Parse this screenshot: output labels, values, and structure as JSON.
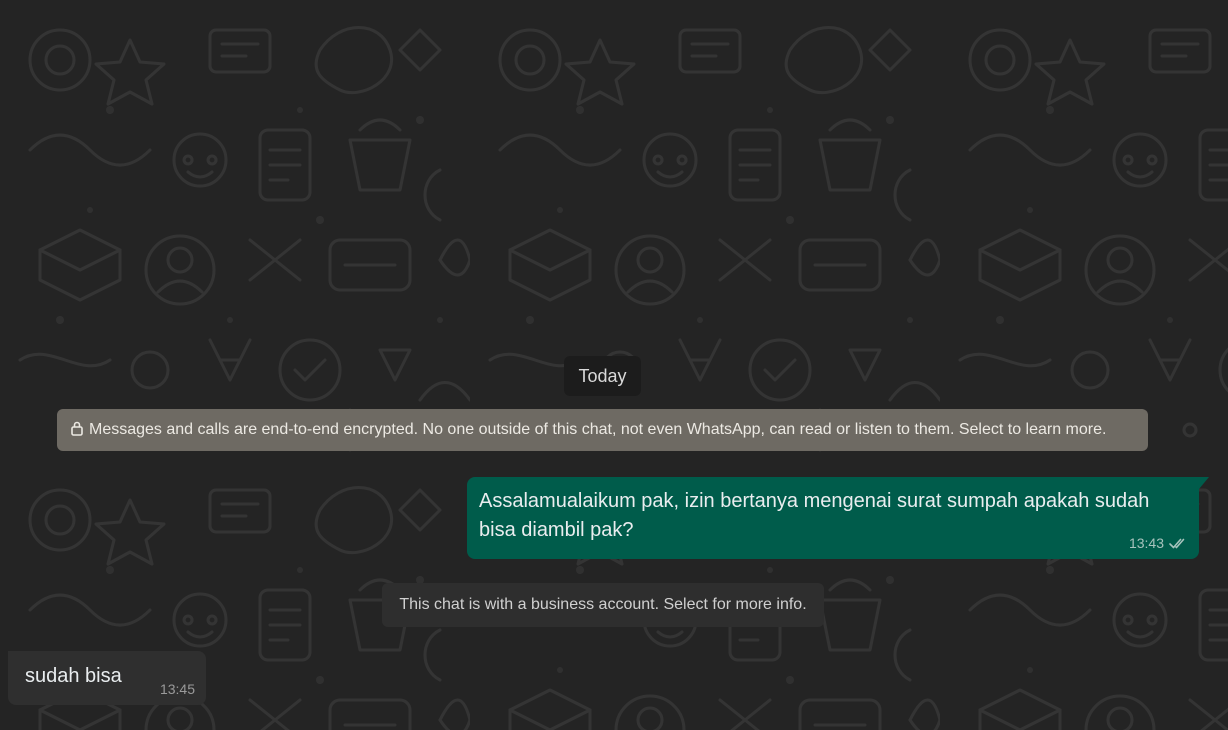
{
  "date_chip": "Today",
  "encryption_notice": {
    "icon": "lock-icon",
    "text": "Messages and calls are end-to-end encrypted. No one outside of this chat, not even WhatsApp, can read or listen to them. Select to learn more."
  },
  "messages": [
    {
      "direction": "outgoing",
      "text": "Assalamualaikum pak, izin bertanya mengenai surat sumpah apakah sudah bisa diambil pak?",
      "time": "13:43",
      "status_icon": "double-check-icon"
    },
    {
      "direction": "incoming",
      "text": "sudah bisa",
      "time": "13:45"
    }
  ],
  "business_notice": "This chat is with a business account. Select for more info.",
  "colors": {
    "background": "#242424",
    "outgoing_bubble": "#005c4b",
    "incoming_bubble": "#2f2f2f",
    "encryption_banner": "#6e6a63"
  }
}
